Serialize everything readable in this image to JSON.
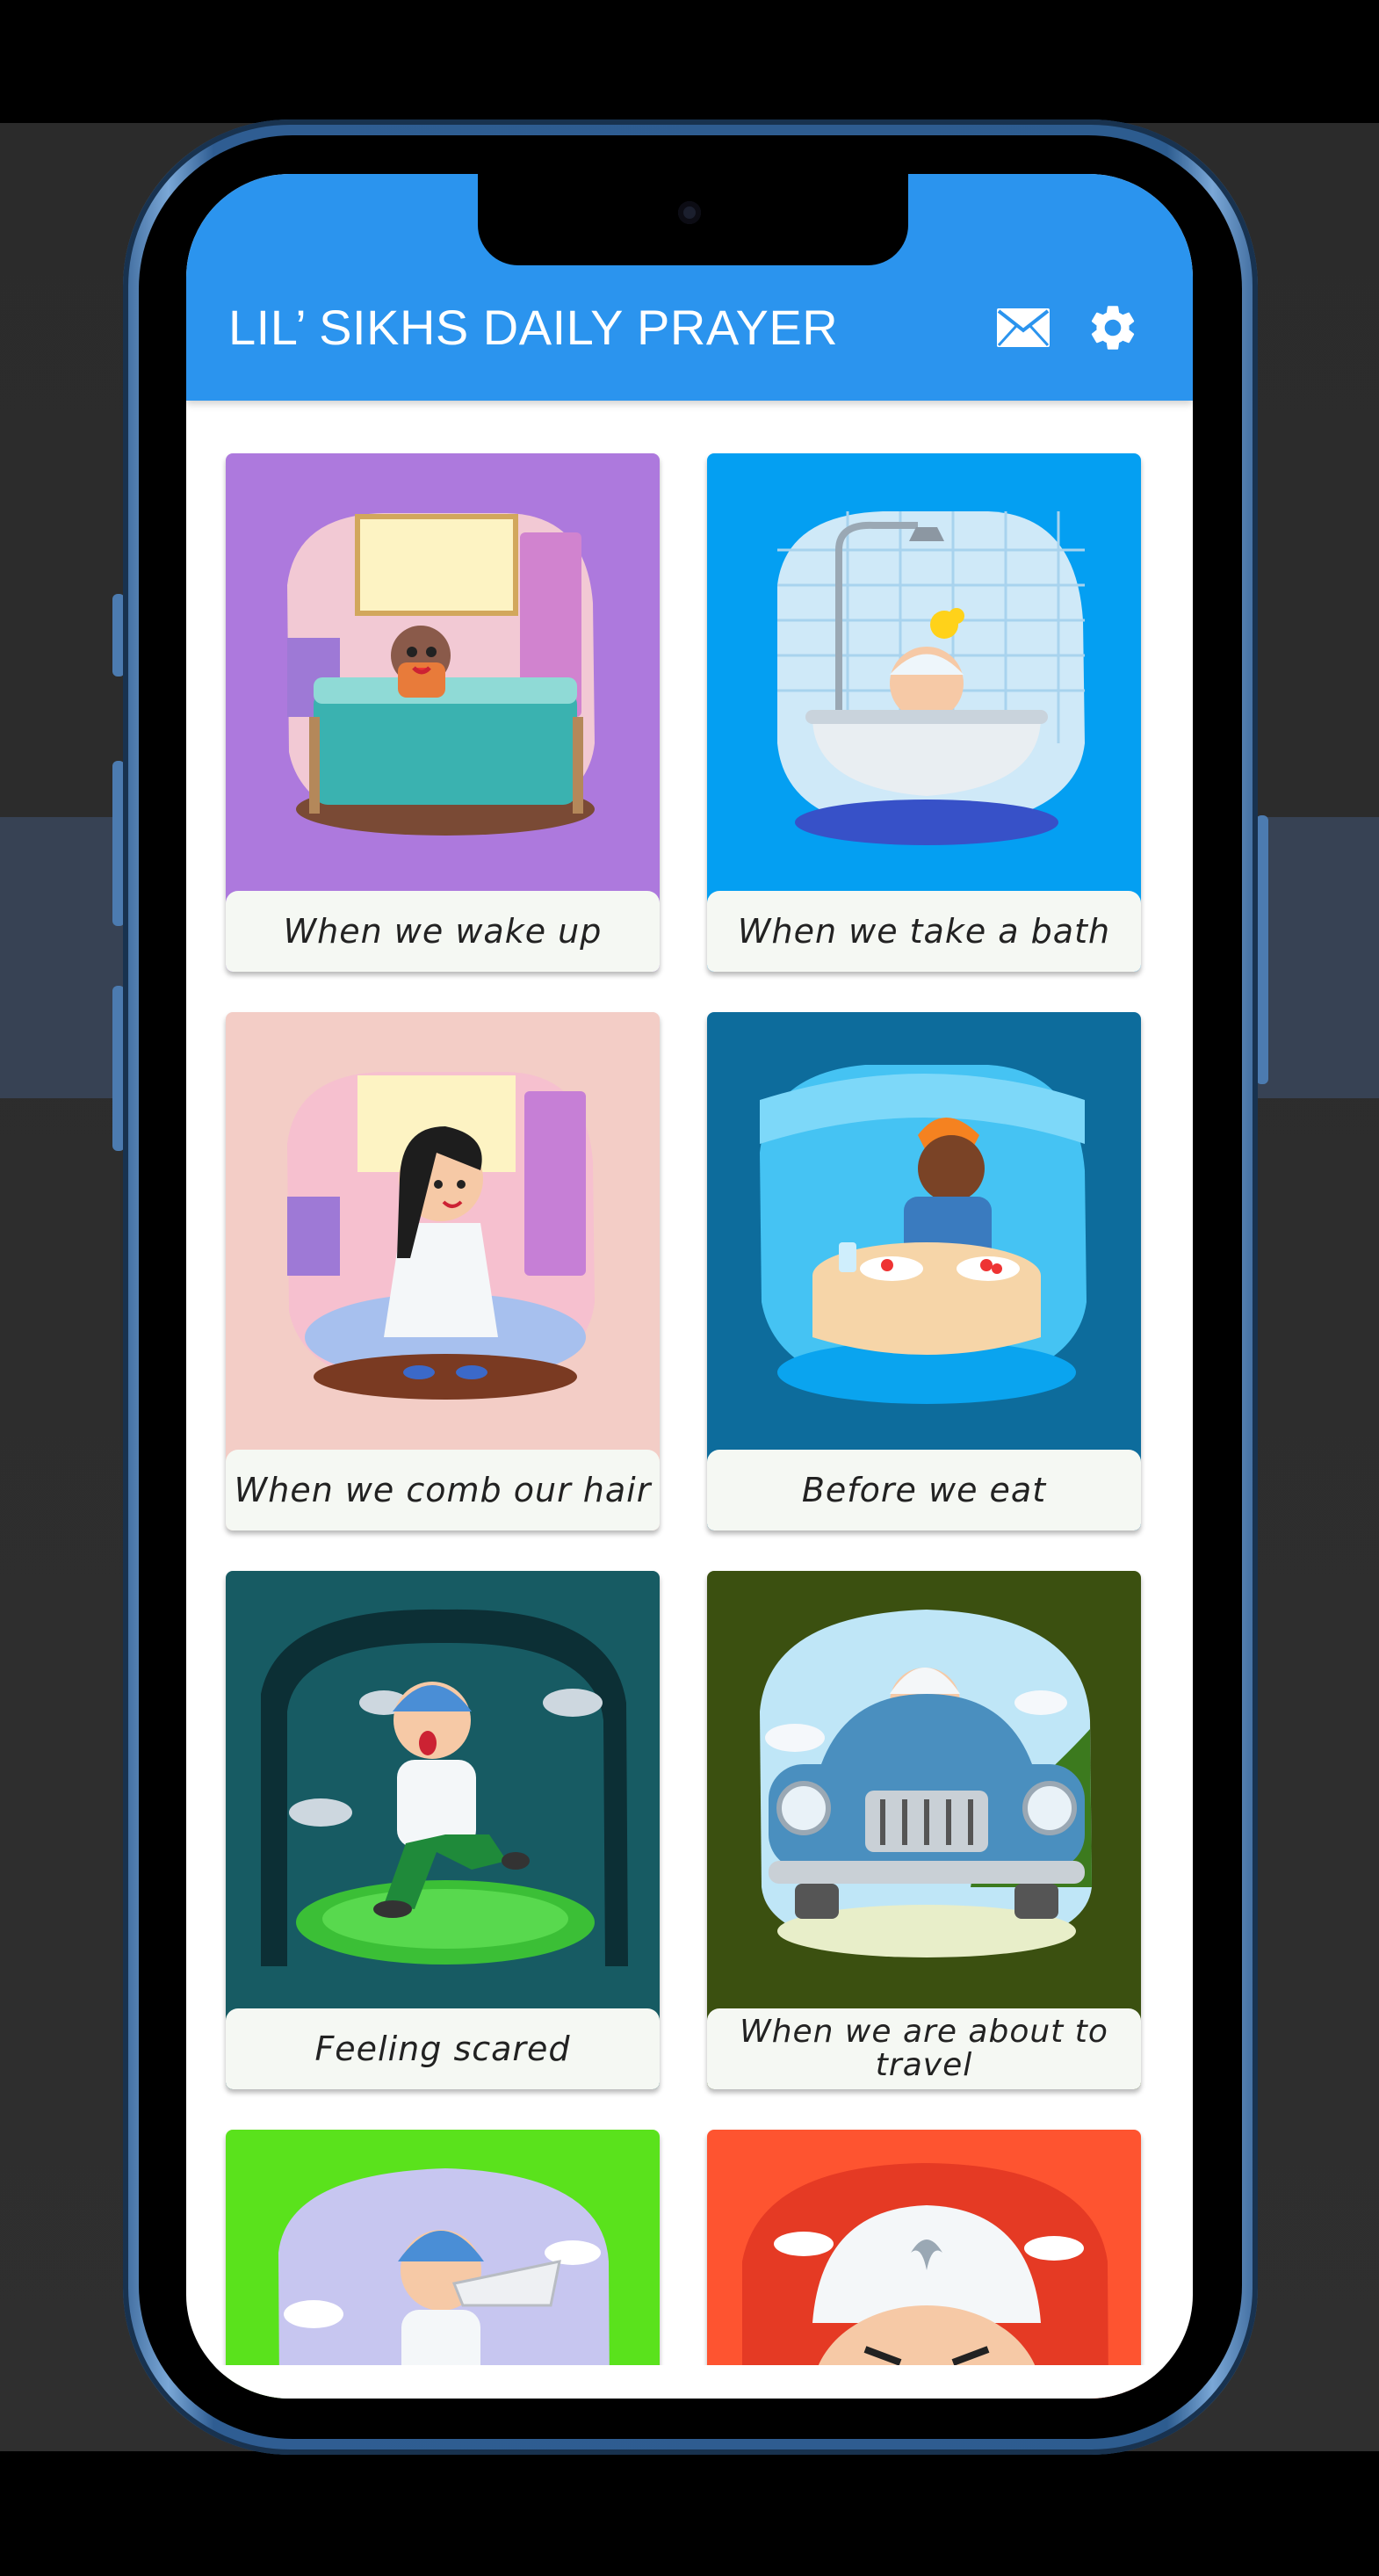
{
  "app": {
    "title": "LIL’ SIKHS DAILY PRAYER"
  },
  "toolbar": {
    "mail_icon": "mail-icon",
    "settings_icon": "gear-icon"
  },
  "colors": {
    "appbar": "#2b94ee",
    "card_purple": "#ad79dd",
    "card_blue": "#049ff2",
    "card_pink": "#f3cdc6",
    "card_navy": "#0d6c9c",
    "card_teal": "#175b63",
    "card_olive": "#3b5010",
    "card_green": "#5ae21c",
    "card_red": "#fe5430"
  },
  "cards": [
    {
      "label": "When we wake up",
      "color": "#ad79dd"
    },
    {
      "label": "When we take a bath",
      "color": "#049ff2"
    },
    {
      "label": "When we comb our hair",
      "color": "#f3cdc6"
    },
    {
      "label": "Before we eat",
      "color": "#0d6c9c"
    },
    {
      "label": "Feeling scared",
      "color": "#175b63"
    },
    {
      "label": "When we are about to travel",
      "color": "#3b5010"
    },
    {
      "label": "",
      "color": "#5ae21c"
    },
    {
      "label": "",
      "color": "#fe5430"
    }
  ]
}
